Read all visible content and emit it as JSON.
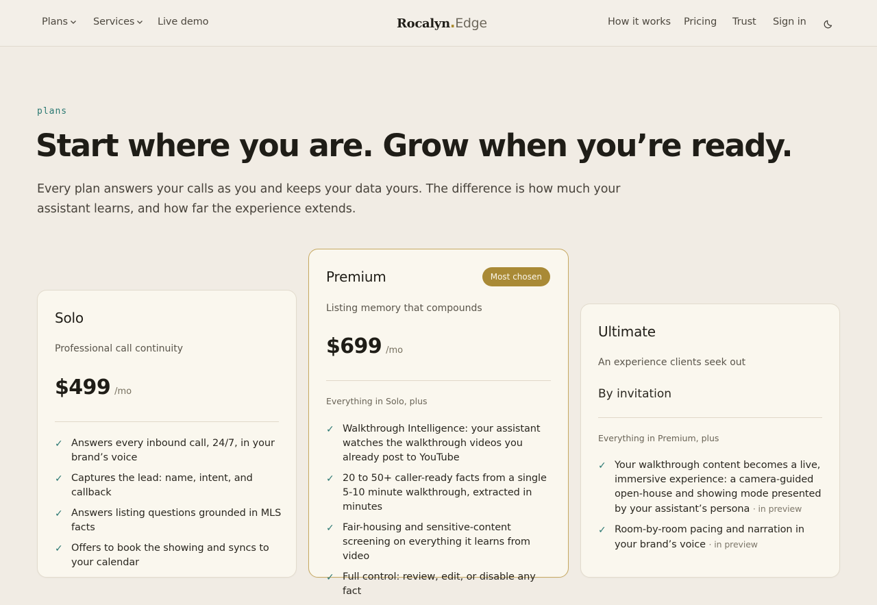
{
  "nav": {
    "left": [
      {
        "label": "Plans",
        "dropdown": true
      },
      {
        "label": "Services",
        "dropdown": true
      },
      {
        "label": "Live demo",
        "dropdown": false
      }
    ],
    "logo": {
      "part1": "Rocalyn",
      "dot": ".",
      "part2": "Edge"
    },
    "right": [
      "How it works",
      "Pricing",
      "Trust",
      "Sign in"
    ],
    "theme_toggle_icon": "moon-icon"
  },
  "hero": {
    "eyebrow": "plans",
    "headline": "Start where you are. Grow when you’re ready.",
    "lede": "Every plan answers your calls as you and keeps your data yours. The difference is how much your assistant learns, and how far the experience extends."
  },
  "colors": {
    "accent_gold": "#a98a36",
    "accent_teal": "#2a7872",
    "background": "#f1ece4"
  },
  "plans": [
    {
      "name": "Solo",
      "tagline": "Professional call continuity",
      "price": "$499",
      "period": "/mo",
      "features": [
        {
          "text": "Answers every inbound call, 24/7, in your brand’s voice"
        },
        {
          "text": "Captures the lead: name, intent, and callback"
        },
        {
          "text": "Answers listing questions grounded in MLS facts"
        },
        {
          "text": "Offers to book the showing and syncs to your calendar"
        }
      ]
    },
    {
      "name": "Premium",
      "badge": "Most chosen",
      "tagline": "Listing memory that compounds",
      "price": "$699",
      "period": "/mo",
      "includes": "Everything in Solo, plus",
      "features": [
        {
          "text": "Walkthrough Intelligence: your assistant watches the walkthrough videos you already post to YouTube"
        },
        {
          "text": "20 to 50+ caller-ready facts from a single 5-10 minute walkthrough, extracted in minutes"
        },
        {
          "text": "Fair-housing and sensitive-content screening on everything it learns from video"
        },
        {
          "text": "Full control: review, edit, or disable any fact"
        }
      ]
    },
    {
      "name": "Ultimate",
      "tagline": "An experience clients seek out",
      "invite": "By invitation",
      "includes": "Everything in Premium, plus",
      "features": [
        {
          "text": "Your walkthrough content becomes a live, immersive experience: a camera-guided open-house and showing mode presented by your assistant’s persona",
          "note": "· in preview"
        },
        {
          "text": "Room-by-room pacing and narration in your brand’s voice",
          "note": "· in preview"
        }
      ]
    }
  ]
}
